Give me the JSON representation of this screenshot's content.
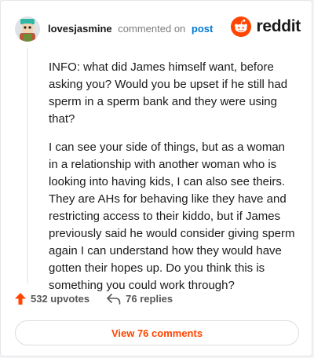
{
  "header": {
    "username": "lovesjasmine",
    "action": "commented on",
    "post_link": "post",
    "brand": "reddit"
  },
  "comment": {
    "paragraphs": [
      "INFO: what did James himself want, before asking you? Would you be upset if he still had sperm in a sperm bank and they were using that?",
      "I can see your side of things, but as a woman in a relationship with another woman who is looking into having kids, I can also see theirs. They are AHs for behaving like they have and restricting access to their kiddo, but if James previously said he would consider giving sperm again I can understand how they would have gotten their hopes up. Do you think this is something you could work through?"
    ]
  },
  "footer": {
    "upvotes": "532 upvotes",
    "replies": "76 replies",
    "view_comments": "View 76 comments"
  },
  "colors": {
    "upvote": "#ff4500",
    "link": "#0079d3",
    "brand": "#ff4500"
  },
  "icons": {
    "upvote": "upvote-arrow-icon",
    "reply": "reply-arrow-icon",
    "brand": "reddit-snoo-icon"
  }
}
